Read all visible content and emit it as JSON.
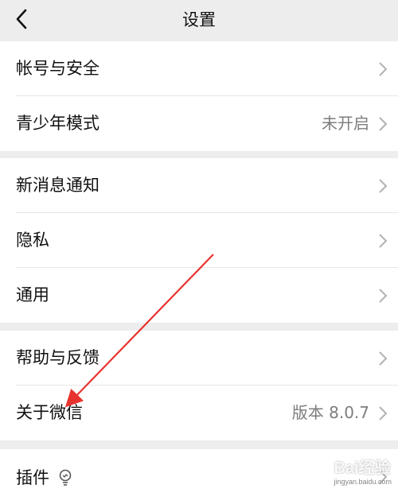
{
  "header": {
    "title": "设置"
  },
  "groups": [
    {
      "rows": [
        {
          "label": "帐号与安全",
          "value": ""
        },
        {
          "label": "青少年模式",
          "value": "未开启"
        }
      ]
    },
    {
      "rows": [
        {
          "label": "新消息通知",
          "value": ""
        },
        {
          "label": "隐私",
          "value": ""
        },
        {
          "label": "通用",
          "value": ""
        }
      ]
    },
    {
      "rows": [
        {
          "label": "帮助与反馈",
          "value": ""
        },
        {
          "label": "关于微信",
          "value": "版本 8.0.7"
        }
      ]
    },
    {
      "rows": [
        {
          "label": "插件",
          "value": ""
        }
      ]
    }
  ],
  "icons": {
    "back": "chevron-left-icon",
    "row_chevron": "chevron-right-icon",
    "plugin_badge": "lightbulb-icon"
  },
  "annotation": {
    "arrow_color": "#e8322e"
  },
  "watermark": {
    "brand": "Bai经验",
    "domain": "jingyan.baidu.com"
  },
  "colors": {
    "background": "#ededed",
    "card": "#ffffff",
    "text_primary": "#111111",
    "text_secondary": "#7d7d7d",
    "chevron": "#b2b2b2"
  }
}
